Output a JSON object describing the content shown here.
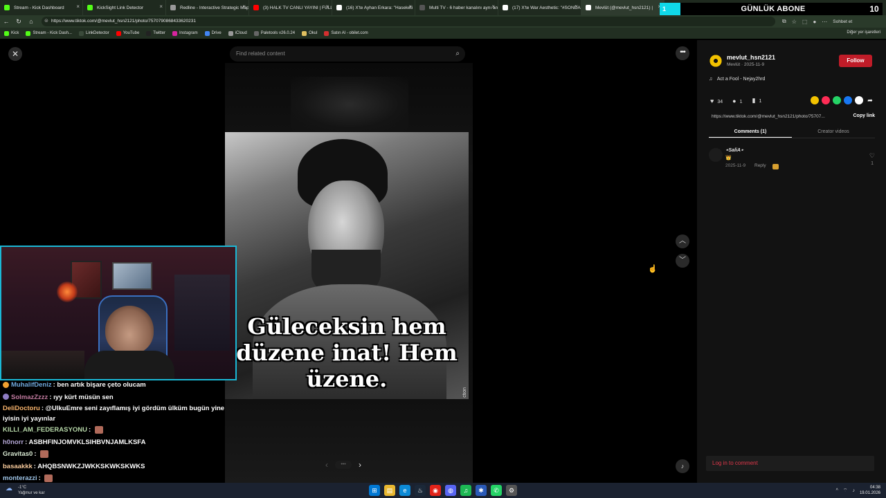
{
  "browser": {
    "tabs": [
      {
        "label": "Stream - Kick Dashboard",
        "icon": "kick-icon",
        "color": "#53fc18"
      },
      {
        "label": "KickSight Link Detector",
        "icon": "kicksight-icon",
        "color": "#53fc18"
      },
      {
        "label": "Redline - Interactive Strategic Map",
        "icon": "redline-icon",
        "color": "#999999"
      },
      {
        "label": "(3) HALK TV CANLI YAYINI | FULL HD",
        "icon": "youtube-icon",
        "color": "#ff0000"
      },
      {
        "label": "(16) X'te Ayhan Erkara: \"Haseketi",
        "icon": "x-icon",
        "color": "#ffffff"
      },
      {
        "label": "Multi TV - 6 haber kanalını aynı an",
        "icon": "multitv-icon",
        "color": "#555555"
      },
      {
        "label": "(17) X'te War Aesthetic: \"#SONDA",
        "icon": "x-icon",
        "color": "#ffffff"
      },
      {
        "label": "Mevlüt (@mevlut_hsn2121) |",
        "icon": "tiktok-icon",
        "color": "#ffffff"
      }
    ],
    "url": "https://www.tiktok.com/@mevlut_hsn2121/photo/7570790868433620231",
    "chat_button": "Sohbet et",
    "bookmarks": [
      {
        "label": "Kick",
        "icon": "kick-icon",
        "color": "#53fc18"
      },
      {
        "label": "Stream - Kick Dash...",
        "icon": "kick-icon",
        "color": "#53fc18"
      },
      {
        "label": "LinkDetector",
        "icon": "link-icon",
        "color": "#3a4a3a"
      },
      {
        "label": "YouTube",
        "icon": "youtube-icon",
        "color": "#ff0000"
      },
      {
        "label": "Twitter",
        "icon": "x-icon",
        "color": "#222222"
      },
      {
        "label": "Instagram",
        "icon": "instagram-icon",
        "color": "#d6249f"
      },
      {
        "label": "Drive",
        "icon": "drive-icon",
        "color": "#4285f4"
      },
      {
        "label": "iCloud",
        "icon": "cloud-icon",
        "color": "#999999"
      },
      {
        "label": "Paletools v26.0.24",
        "icon": "globe-icon",
        "color": "#666666"
      },
      {
        "label": "Okul",
        "icon": "folder-icon",
        "color": "#e0c060"
      },
      {
        "label": "Satın Al - obilet.com",
        "icon": "obilet-icon",
        "color": "#d32f2f"
      }
    ],
    "bookmarks_other": "Diğer yer işaretleri"
  },
  "banner": {
    "label": "GÜNLÜK ABONE",
    "count": "10",
    "left_tag": "1"
  },
  "page": {
    "search_placeholder": "Find related content",
    "caption": "Güleceksin hem düzene inat! Hem üzene.",
    "side_tag": "ction"
  },
  "panel": {
    "username": "mevlut_hsn2121",
    "subline": "Mevlüt · 2025-11-9",
    "follow": "Follow",
    "music": "Act a Fool - Nejay2hrd",
    "likes": "34",
    "comments": "1",
    "saves": "1",
    "share_colors": [
      "#f2c200",
      "#fe2c55",
      "#25d366",
      "#1877f2",
      "#ffffff"
    ],
    "link": "https://www.tiktok.com/@mevlut_hsn2121/photo/75707...",
    "copy_link": "Copy link",
    "tab_comments": "Comments (1)",
    "tab_creator": "Creator videos",
    "comment": {
      "name": "⋆SaliA⋆",
      "emoji": "👑",
      "date": "2025-11-9",
      "reply": "Reply",
      "likes": "1"
    },
    "login": "Log in to comment"
  },
  "chat": [
    {
      "user": "MuhalifDeniz",
      "color": "#6fa8dc",
      "badge": "#f0a030",
      "text": "ben artık bişare çeto olucam"
    },
    {
      "user": "SolmazZzzz",
      "color": "#c27ba0",
      "badge": "#8e7cc3",
      "text": "ıyy kürt müsün sen"
    },
    {
      "user": "DeliDoctoru",
      "color": "#f6b26b",
      "badge": "",
      "text": "@UlkuEmre seni zayıflamış iyi gördüm ülküm bugün yine iyisin iyi yayınlar"
    },
    {
      "user": "KILLI_AM_FEDERASYONU",
      "color": "#b6d7a8",
      "badge": "",
      "text": ""
    },
    {
      "user": "h0norr",
      "color": "#b4a7d6",
      "badge": "",
      "text": "ASBHFINJOMVKLSIHBVNJAMLKSFA"
    },
    {
      "user": "Gravitas0",
      "color": "#d9ead3",
      "badge": "",
      "text": ""
    },
    {
      "user": "basaakkk",
      "color": "#f9cb9c",
      "badge": "",
      "text": "AHQBSNWKZJWKKSKWKSKWKS"
    },
    {
      "user": "monterazzi",
      "color": "#9fc5e8",
      "badge": "",
      "text": ""
    }
  ],
  "taskbar": {
    "temp": "-1°C",
    "weather": "Yağmur ve kar",
    "time": "04:38",
    "date": "19.01.2026"
  }
}
